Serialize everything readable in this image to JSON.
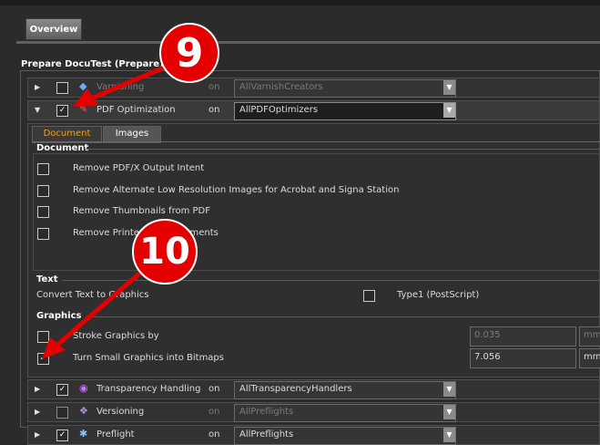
{
  "tab": {
    "label": "Overview"
  },
  "section_title": "Prepare DocuTest (Prepare)",
  "rows": [
    {
      "label": "Varnishing",
      "on": "on",
      "value": "AllVarnishCreators",
      "checked": false,
      "enabled": false,
      "icon": "varnish-icon"
    },
    {
      "label": "PDF Optimization",
      "on": "on",
      "value": "AllPDFOptimizers",
      "checked": true,
      "enabled": true,
      "icon": "pdf-optimization-icon"
    },
    {
      "label": "Transparency Handling",
      "on": "on",
      "value": "AllTransparencyHandlers",
      "checked": true,
      "enabled": true,
      "icon": "transparency-icon"
    },
    {
      "label": "Versioning",
      "on": "on",
      "value": "AllPreflights",
      "checked": false,
      "enabled": false,
      "icon": "versioning-icon"
    },
    {
      "label": "Preflight",
      "on": "on",
      "value": "AllPreflights",
      "checked": true,
      "enabled": true,
      "icon": "preflight-icon"
    }
  ],
  "subtabs": {
    "document": "Document",
    "images": "Images"
  },
  "document_group": {
    "title": "Document",
    "options": [
      {
        "label": "Remove PDF/X Output Intent",
        "checked": false
      },
      {
        "label": "Remove Alternate Low Resolution Images for Acrobat and Signa Station",
        "checked": false
      },
      {
        "label": "Remove Thumbnails from PDF",
        "checked": false
      },
      {
        "label": "Remove Printer Marks Elements",
        "checked": false
      }
    ]
  },
  "text_group": {
    "title": "Text",
    "convert_label": "Convert Text to Graphics",
    "type1_label": "Type1 (PostScript)",
    "type1_checked": false
  },
  "graphics_group": {
    "title": "Graphics",
    "stroke_label": "Stroke Graphics by",
    "stroke_value": "0.035",
    "stroke_unit": "mm",
    "stroke_checked": false,
    "bitmap_label": "Turn Small Graphics into Bitmaps",
    "bitmap_value": "7.056",
    "bitmap_unit": "mm",
    "bitmap_checked": true
  },
  "markers": {
    "m9": "9",
    "m10": "10"
  },
  "colors": {
    "marker_red": "#e50000",
    "accent_orange": "#f0a020"
  }
}
